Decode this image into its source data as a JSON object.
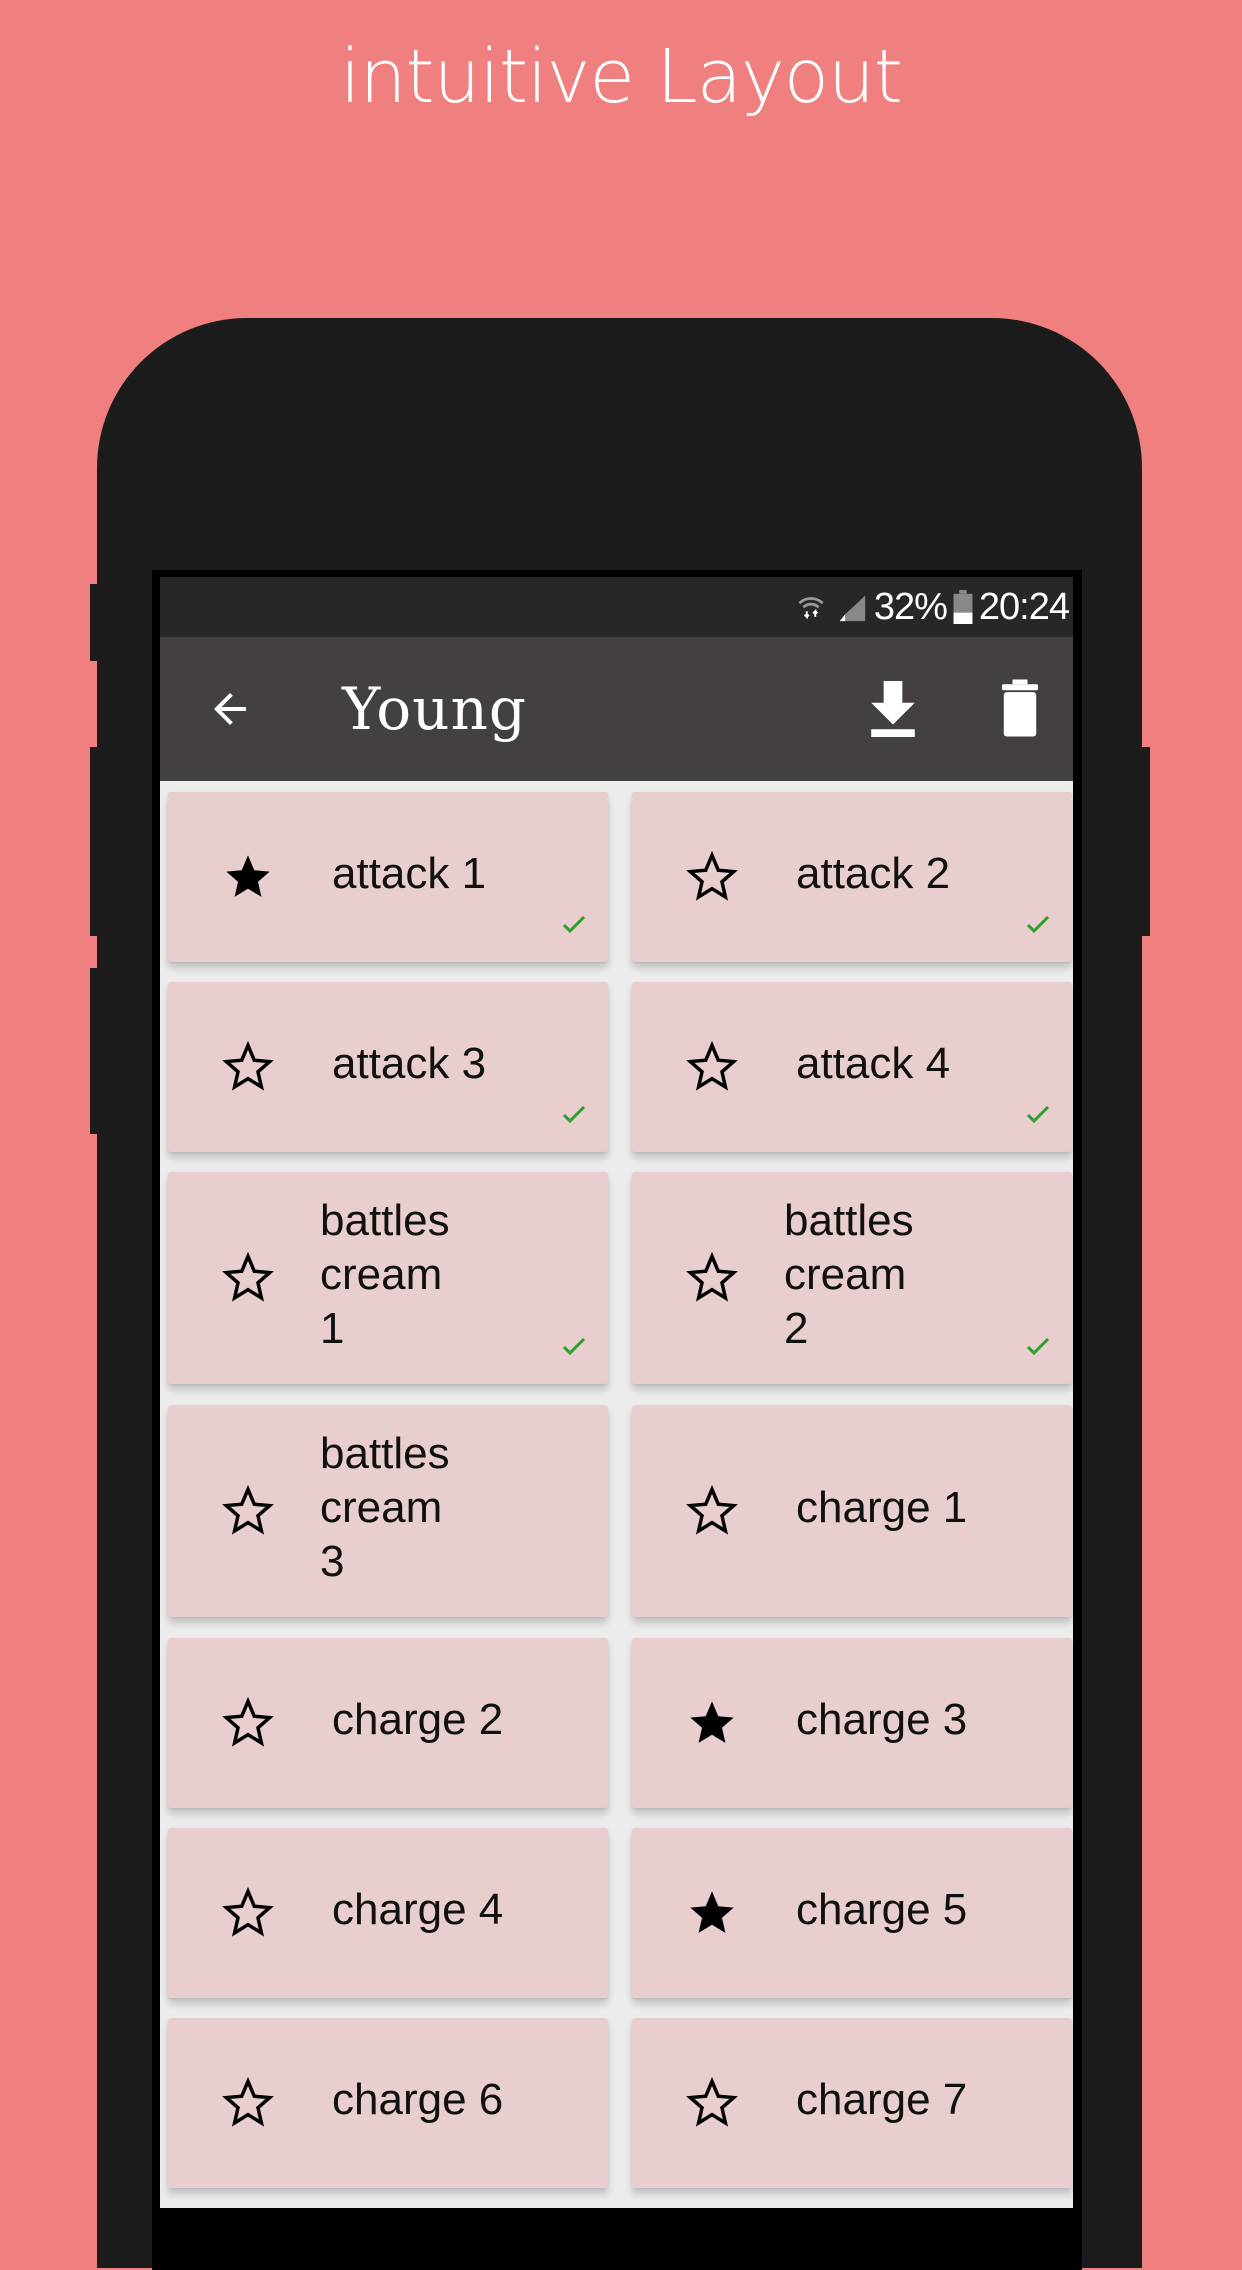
{
  "promo": {
    "headline": "intuitive Layout"
  },
  "status_bar": {
    "battery_percent": "32%",
    "time": "20:24",
    "icons": [
      "wifi-icon",
      "signal-icon",
      "battery-icon"
    ]
  },
  "toolbar": {
    "title": "Young",
    "back_icon": "arrow-left-icon",
    "download_icon": "download-icon",
    "delete_icon": "trash-icon"
  },
  "colors": {
    "background": "#f08080",
    "phone": "#1c1c1c",
    "toolbar": "#444040",
    "status_bar": "#282626",
    "card": "#e8cece",
    "check": "#2ca02c"
  },
  "items": [
    {
      "label": "attack 1",
      "favorite": true,
      "done": true
    },
    {
      "label": "attack 2",
      "favorite": false,
      "done": true
    },
    {
      "label": "attack 3",
      "favorite": false,
      "done": true
    },
    {
      "label": "attack 4",
      "favorite": false,
      "done": true
    },
    {
      "label": " battles\ncream\n1",
      "favorite": false,
      "done": true
    },
    {
      "label": " battles\ncream\n2",
      "favorite": false,
      "done": true
    },
    {
      "label": " battles\ncream\n3",
      "favorite": false,
      "done": false
    },
    {
      "label": "charge 1",
      "favorite": false,
      "done": false
    },
    {
      "label": "charge 2",
      "favorite": false,
      "done": false
    },
    {
      "label": "charge 3",
      "favorite": true,
      "done": false
    },
    {
      "label": "charge 4",
      "favorite": false,
      "done": false
    },
    {
      "label": "charge 5",
      "favorite": true,
      "done": false
    },
    {
      "label": "charge 6",
      "favorite": false,
      "done": false
    },
    {
      "label": "charge 7",
      "favorite": false,
      "done": false
    }
  ]
}
